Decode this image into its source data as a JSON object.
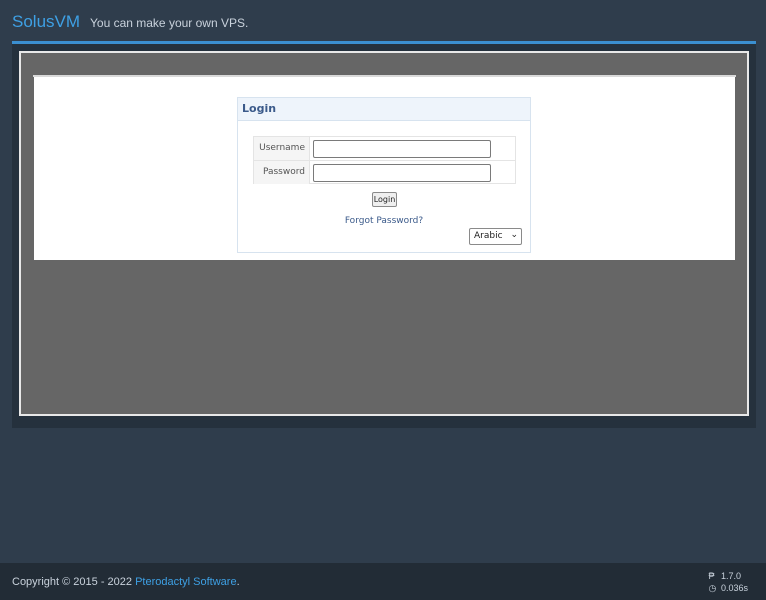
{
  "header": {
    "brand": "SolusVM",
    "tagline": "You can make your own VPS."
  },
  "login": {
    "title": "Login",
    "username_label": "Username",
    "password_label": "Password",
    "username_value": "",
    "password_value": "",
    "submit_label": "Login",
    "forgot_label": "Forgot Password?",
    "language_selected": "Arabic"
  },
  "footer": {
    "copyright_prefix": "Copyright © 2015 - 2022",
    "company_link": "Pterodactyl Software",
    "copyright_suffix": ".",
    "version": "1.7.0",
    "load_time": "0.036s",
    "version_icon": "version-icon",
    "clock_icon": "clock-icon"
  },
  "colors": {
    "brand": "#3ea0e4",
    "page_bg": "#2f3d4c",
    "frame_bg": "#666666"
  }
}
